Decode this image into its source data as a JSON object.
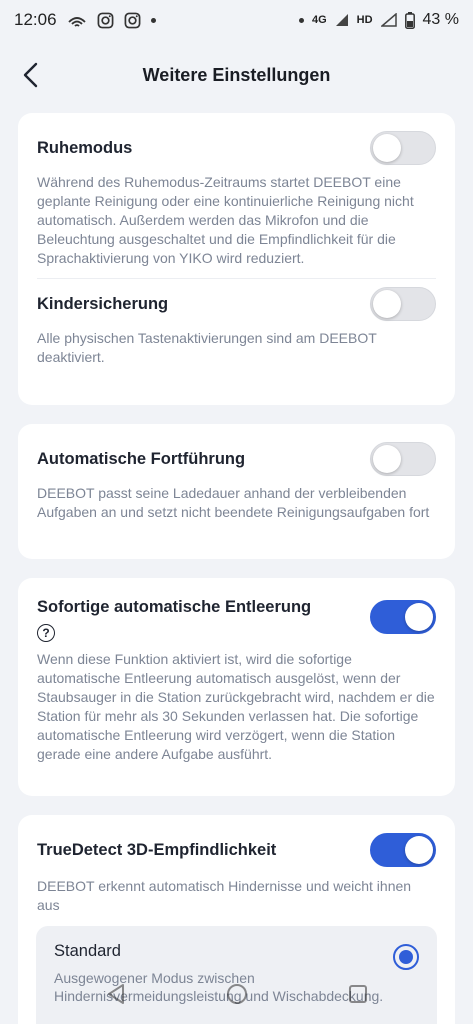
{
  "status": {
    "time": "12:06",
    "signal": "4G",
    "hd": "HD",
    "battery": "43 %"
  },
  "header": {
    "title": "Weitere Einstellungen",
    "back_icon": "chevron-left-icon"
  },
  "cards": {
    "ruhemodus": {
      "title": "Ruhemodus",
      "enabled": false,
      "desc": "Während des Ruhemodus-Zeitraums startet DEEBOT eine geplante Reinigung oder eine kontinuierliche Reinigung nicht automatisch. Außerdem werden das Mikrofon und die Beleuchtung ausgeschaltet und die Empfindlichkeit für die Sprachaktivierung von YIKO wird reduziert."
    },
    "kindersicherung": {
      "title": "Kindersicherung",
      "enabled": false,
      "desc": "Alle physischen Tastenaktivierungen sind am DEEBOT deaktiviert."
    },
    "fortfuehrung": {
      "title": "Automatische Fortführung",
      "enabled": false,
      "desc": "DEEBOT passt seine Ladedauer anhand der verbleibenden Aufgaben an und setzt nicht beendete Reinigungsaufgaben fort"
    },
    "entleerung": {
      "title": "Sofortige automatische Entleerung",
      "enabled": true,
      "help": "?",
      "desc": "Wenn diese Funktion aktiviert ist, wird die sofortige automatische Entleerung automatisch ausgelöst, wenn der Staubsauger in die Station zurückgebracht wird, nachdem er die Station für mehr als 30 Sekunden verlassen hat. Die sofortige automatische Entleerung wird verzögert, wenn die Station gerade eine andere Aufgabe ausführt."
    },
    "truedetect": {
      "title": "TrueDetect 3D-Empfindlichkeit",
      "enabled": true,
      "desc": "DEEBOT erkennt automatisch Hindernisse und weicht ihnen aus",
      "option": {
        "title": "Standard",
        "selected": true,
        "desc": "Ausgewogener Modus zwischen Hindernisvermeidungsleistung und Wischabdeckung."
      }
    }
  },
  "colors": {
    "accent": "#2f5ed8",
    "background": "#f1f3f7"
  }
}
